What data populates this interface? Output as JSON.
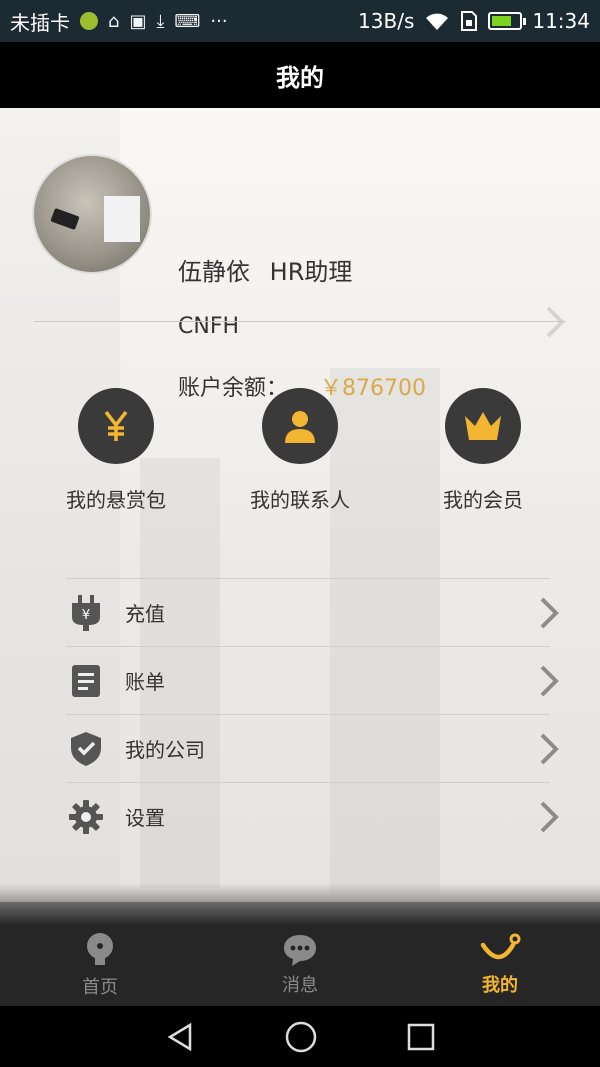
{
  "status_bar": {
    "carrier": "未插卡",
    "speed": "13B/s",
    "time": "11:34",
    "battery_level": 0.7,
    "icons": [
      "signal-app-icon",
      "android-debug-icon",
      "image-icon",
      "download-icon",
      "keyboard-icon",
      "more-icon",
      "wifi-icon",
      "sim-icon",
      "battery-icon"
    ]
  },
  "header": {
    "title": "我的"
  },
  "profile": {
    "name": "伍静依",
    "role": "HR助理",
    "company": "CNFH",
    "balance_label": "账户余额：",
    "balance_value": "￥876700"
  },
  "quick_actions": [
    {
      "label": "我的悬赏包",
      "icon": "yen-icon"
    },
    {
      "label": "我的联系人",
      "icon": "person-icon"
    },
    {
      "label": "我的会员",
      "icon": "crown-icon"
    }
  ],
  "menu": [
    {
      "label": "充值",
      "icon": "recharge-plug-icon"
    },
    {
      "label": "账单",
      "icon": "bill-icon"
    },
    {
      "label": "我的公司",
      "icon": "shield-check-icon"
    },
    {
      "label": "设置",
      "icon": "gear-icon"
    }
  ],
  "bottom_nav": [
    {
      "label": "首页",
      "icon": "bulb-icon",
      "active": false
    },
    {
      "label": "消息",
      "icon": "chat-icon",
      "active": false
    },
    {
      "label": "我的",
      "icon": "smile-icon",
      "active": true
    }
  ],
  "colors": {
    "accent": "#f2b632",
    "balance": "#d9a94a",
    "dark_circle": "#3a3a3a"
  }
}
